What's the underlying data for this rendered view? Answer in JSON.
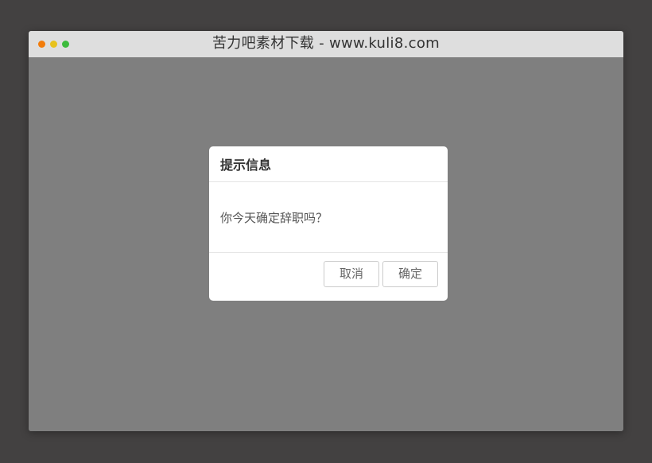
{
  "window": {
    "title": "苦力吧素材下载 - www.kuli8.com",
    "controls": {
      "close_color": "#f27c0b",
      "minimize_color": "#e8c21d",
      "maximize_color": "#3dbb3d"
    },
    "background_color": "#7f7f7f"
  },
  "dialog": {
    "title": "提示信息",
    "message": "你今天确定辞职吗？",
    "buttons": {
      "cancel_label": "取消",
      "confirm_label": "确定"
    }
  }
}
